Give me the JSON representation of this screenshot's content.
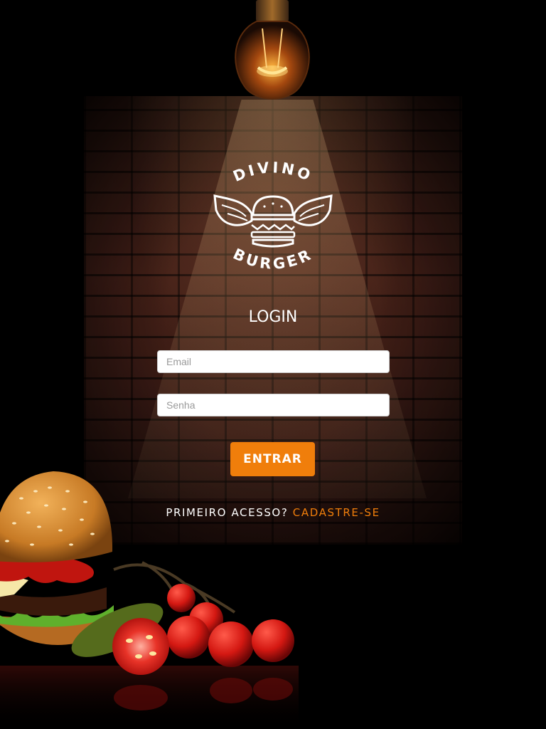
{
  "brand": {
    "name_top": "DIVINO",
    "name_bottom": "BURGER"
  },
  "login": {
    "title": "LOGIN",
    "email_placeholder": "Email",
    "password_placeholder": "Senha",
    "submit_label": "ENTRAR"
  },
  "signup": {
    "prompt": "PRIMEIRO ACESSO?",
    "link_label": "CADASTRE-SE"
  },
  "colors": {
    "accent": "#f07e0b",
    "background": "#000000",
    "text": "#ffffff"
  },
  "icons": [
    "light-bulb-icon",
    "winged-burger-logo-icon"
  ]
}
